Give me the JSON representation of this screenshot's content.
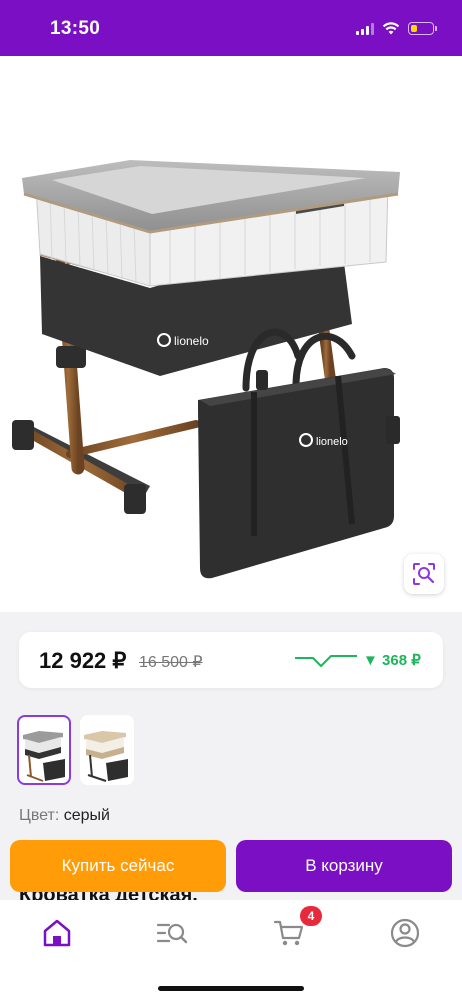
{
  "status_bar": {
    "time": "13:50",
    "battery_level_percent": 30,
    "accent_color": "#7a0fc4"
  },
  "product": {
    "image_brand": "lionelo",
    "bag_brand": "lionelo",
    "price_current": "12 922 ₽",
    "price_old": "16 500 ₽",
    "price_drop": "▼ 368 ₽",
    "color_label": "Цвет:",
    "color_value": "серый",
    "title_peek": "Кроватка детская,"
  },
  "thumbnails": [
    {
      "color": "grey",
      "selected": true
    },
    {
      "color": "beige",
      "selected": false
    }
  ],
  "actions": {
    "buy_now": "Купить сейчас",
    "add_to_cart": "В корзину"
  },
  "tabbar": {
    "tabs": [
      "home-icon",
      "catalog-search-icon",
      "cart-icon",
      "profile-icon"
    ],
    "cart_count": "4",
    "active": "home-icon"
  },
  "colors": {
    "buy_button": "#ff9c08",
    "cart_button": "#7a0fc4",
    "price_drop": "#1fb55a",
    "badge": "#e8283b"
  }
}
